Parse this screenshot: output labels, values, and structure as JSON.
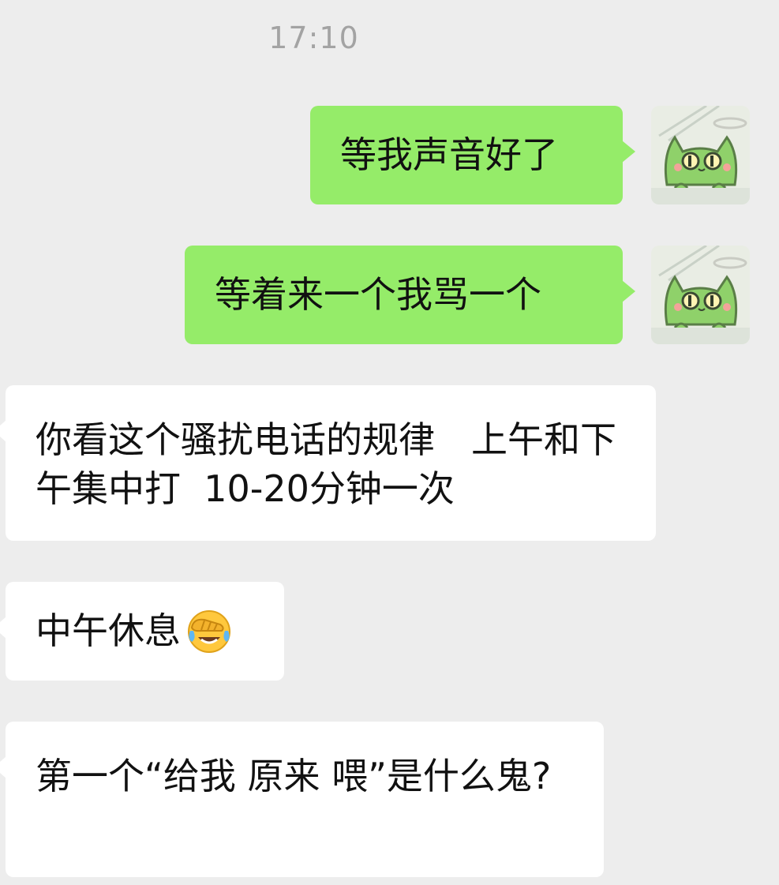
{
  "chat": {
    "timestamp": "17:10",
    "messages": [
      {
        "direction": "out",
        "text": "等我声音好了"
      },
      {
        "direction": "out",
        "text": "等着来一个我骂一个"
      },
      {
        "direction": "in",
        "text": "你看这个骚扰电话的规律　上午和下午集中打  10-20分钟一次"
      },
      {
        "direction": "in",
        "text": "中午休息",
        "emoji": "face-palm-crying-emoji"
      },
      {
        "direction": "in",
        "text": "第一个“给我 原来 喂”是什么鬼?"
      }
    ],
    "avatar": {
      "icon": "green-cat-avatar"
    }
  },
  "colors": {
    "background": "#ededed",
    "outgoing_bubble": "#95ec69",
    "incoming_bubble": "#ffffff",
    "timestamp_text": "#a3a3a3",
    "text": "#111111"
  }
}
